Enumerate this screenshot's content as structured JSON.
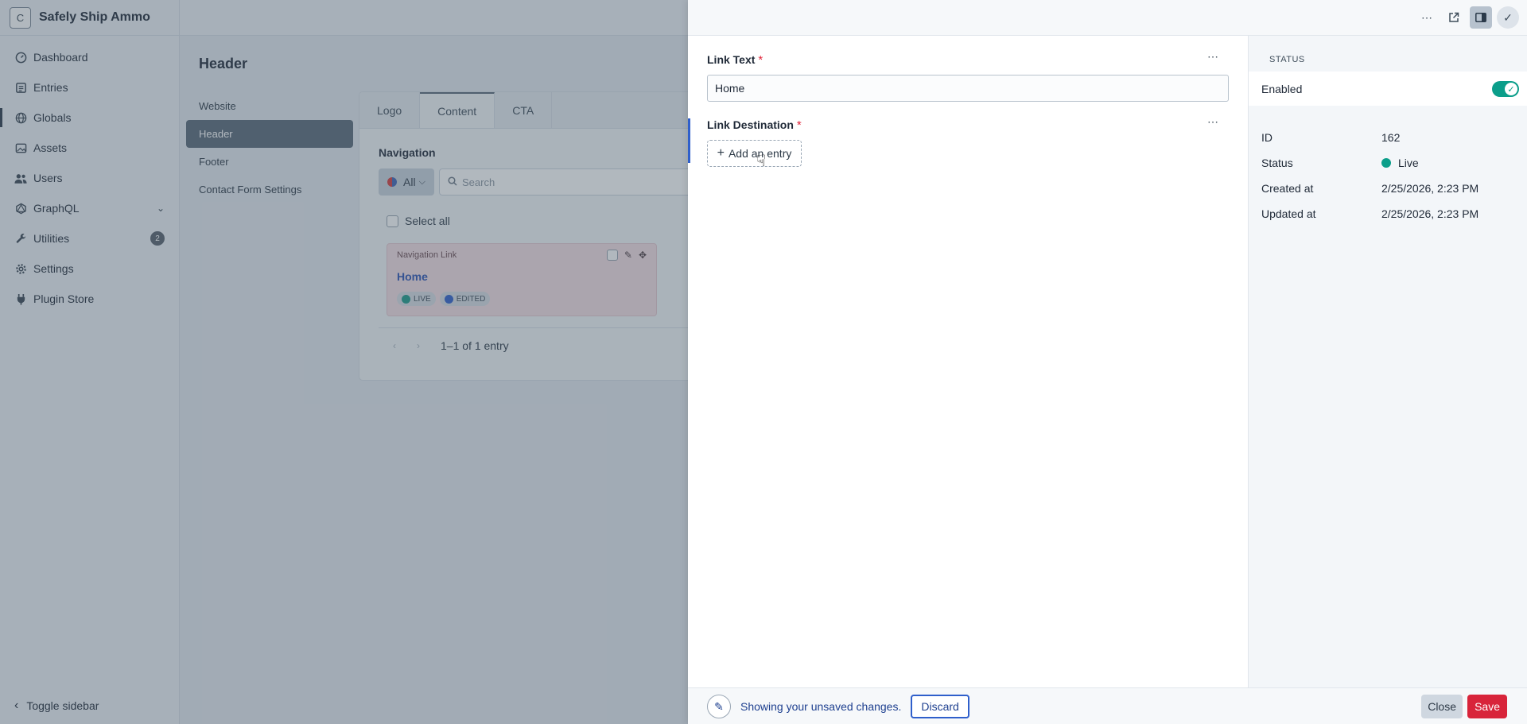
{
  "site": {
    "logo_letter": "C",
    "name": "Safely Ship Ammo"
  },
  "sidebar": {
    "items": [
      {
        "label": "Dashboard",
        "icon": "dashboard-icon"
      },
      {
        "label": "Entries",
        "icon": "entries-icon"
      },
      {
        "label": "Globals",
        "icon": "globe-icon"
      },
      {
        "label": "Assets",
        "icon": "image-icon"
      },
      {
        "label": "Users",
        "icon": "users-icon"
      },
      {
        "label": "GraphQL",
        "icon": "graphql-icon"
      },
      {
        "label": "Utilities",
        "icon": "wrench-icon",
        "badge": "2"
      },
      {
        "label": "Settings",
        "icon": "gear-icon"
      },
      {
        "label": "Plugin Store",
        "icon": "plug-icon"
      }
    ],
    "toggle_label": "Toggle sidebar"
  },
  "page": {
    "title": "Header",
    "sub_nav": [
      "Website",
      "Header",
      "Footer",
      "Contact Form Settings"
    ]
  },
  "card": {
    "tabs": [
      "Logo",
      "Content",
      "CTA"
    ],
    "section_label": "Navigation",
    "filter_label": "All",
    "search_placeholder": "Search",
    "select_all": "Select all",
    "block": {
      "type": "Navigation Link",
      "title": "Home",
      "badges": [
        "LIVE",
        "EDITED"
      ]
    },
    "paging": "1–1 of 1 entry"
  },
  "slideout": {
    "fields": {
      "link_text": {
        "label": "Link Text",
        "required": "*",
        "value": "Home"
      },
      "link_destination": {
        "label": "Link Destination",
        "required": "*",
        "add_label": "Add an entry"
      }
    },
    "meta": {
      "heading": "STATUS",
      "enabled_label": "Enabled",
      "rows": [
        {
          "key": "ID",
          "value": "162"
        },
        {
          "key": "Status",
          "value": "Live"
        },
        {
          "key": "Created at",
          "value": "2/25/2026, 2:23 PM"
        },
        {
          "key": "Updated at",
          "value": "2/25/2026, 2:23 PM"
        }
      ]
    },
    "footer": {
      "notice": "Showing your unsaved changes.",
      "discard": "Discard",
      "close": "Close",
      "save": "Save"
    }
  },
  "colors": {
    "accent_blue": "#2f5fcb",
    "live_green": "#0b9e8a",
    "save_red": "#d8243a"
  }
}
